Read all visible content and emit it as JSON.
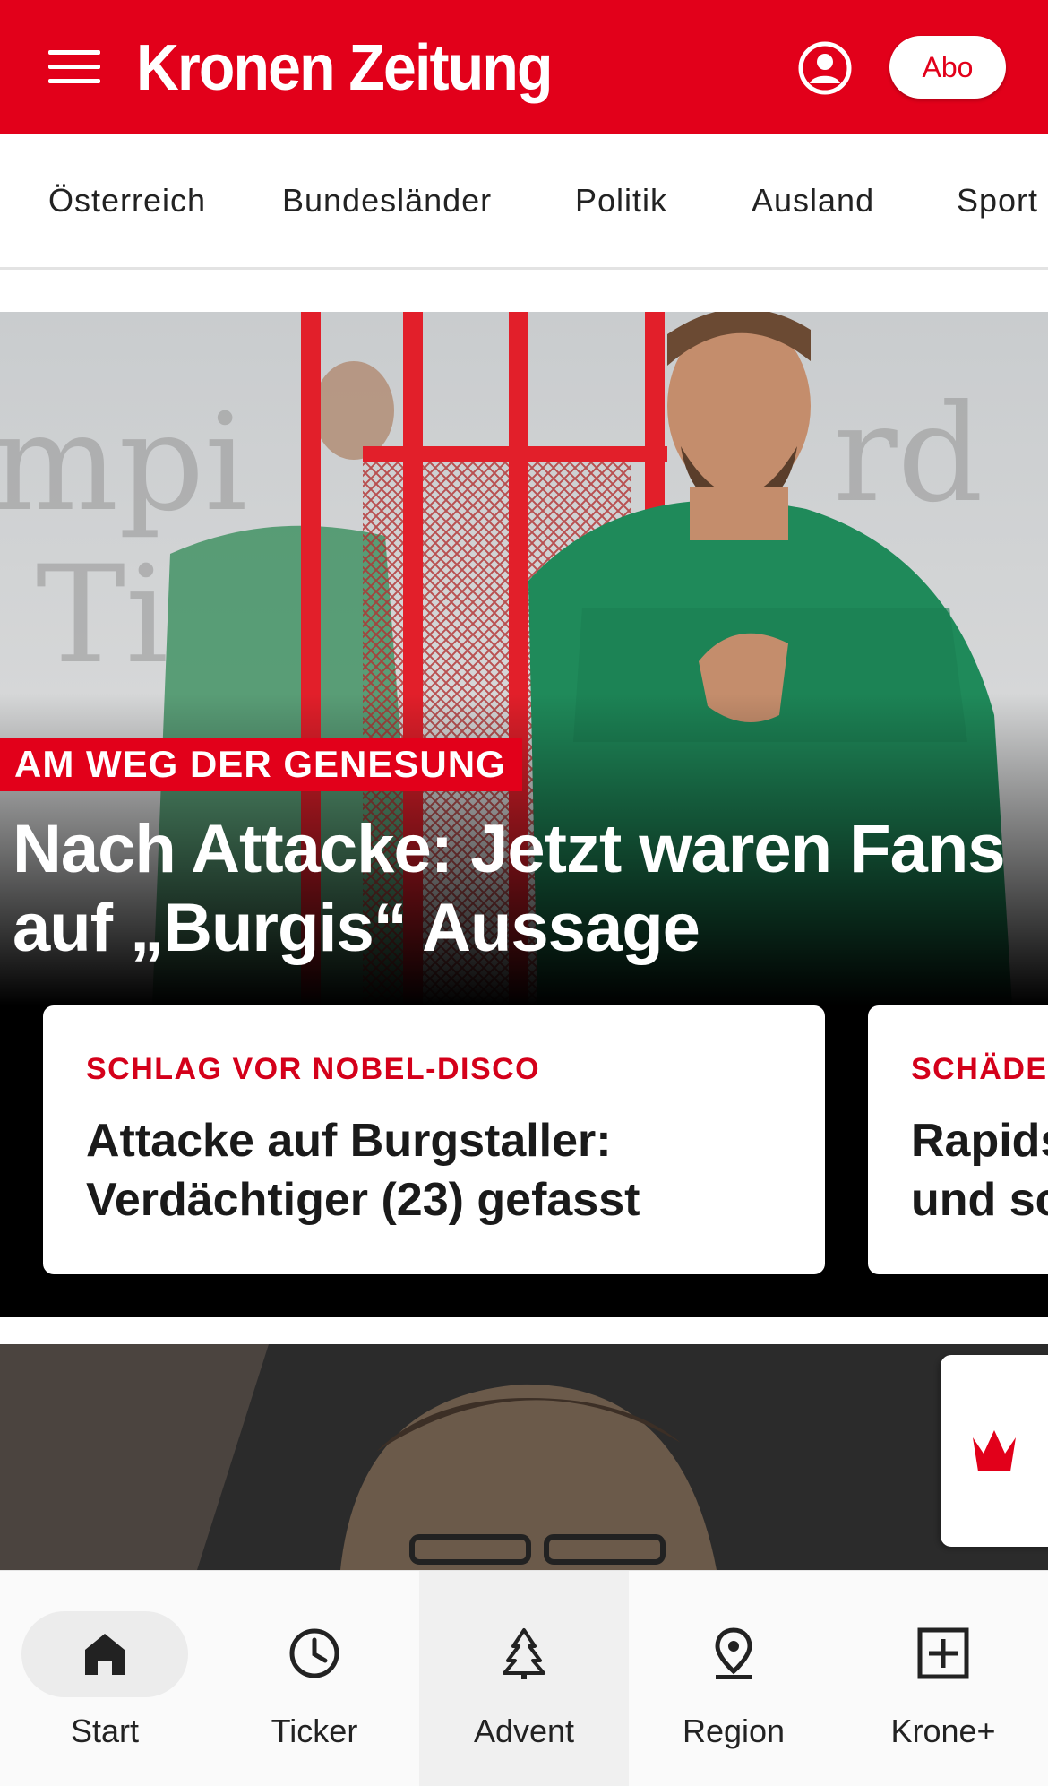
{
  "header": {
    "logo": "Kronen Zeitung",
    "abo_label": "Abo",
    "brand_color": "#e2001a"
  },
  "nav": {
    "items": [
      {
        "label": "Österreich"
      },
      {
        "label": "Bundesländer"
      },
      {
        "label": "Politik"
      },
      {
        "label": "Ausland"
      },
      {
        "label": "Sport"
      }
    ]
  },
  "hero": {
    "kicker": "AM WEG DER GENESUNG",
    "title": "Nach Attacke: Jetzt waren Fans auf „Burgis“ Aussage",
    "image_alt": "soccer-player-training-photo"
  },
  "cards": [
    {
      "kicker": "SCHLAG VOR NOBEL-DISCO",
      "title": "Attacke auf Burgstaller:\nVerdächtiger (23) gefasst"
    },
    {
      "kicker": "SCHÄDEL",
      "title": "Rapids\nund sc"
    }
  ],
  "bottom_nav": {
    "tabs": [
      {
        "label": "Start",
        "icon": "home-icon"
      },
      {
        "label": "Ticker",
        "icon": "clock-icon"
      },
      {
        "label": "Advent",
        "icon": "tree-icon"
      },
      {
        "label": "Region",
        "icon": "location-pin-icon"
      },
      {
        "label": "Krone+",
        "icon": "plus-box-icon"
      }
    ]
  }
}
